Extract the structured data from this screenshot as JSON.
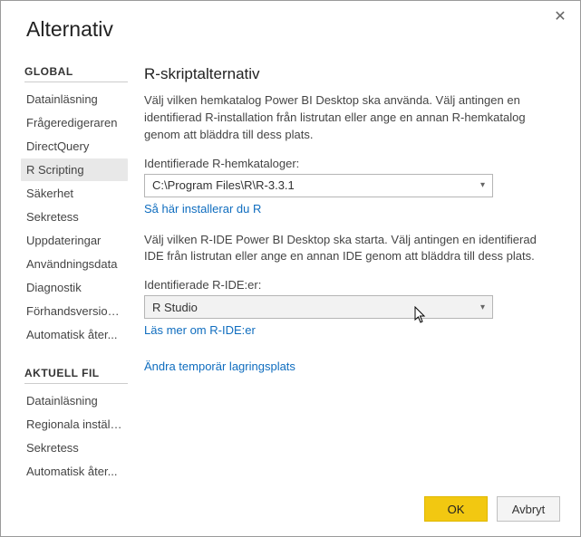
{
  "window": {
    "title": "Alternativ"
  },
  "sidebar": {
    "global_label": "GLOBAL",
    "aktuell_label": "AKTUELL FIL",
    "global_items": [
      "Datainläsning",
      "Frågeredigeraren",
      "DirectQuery",
      "R Scripting",
      "Säkerhet",
      "Sekretess",
      "Uppdateringar",
      "Användningsdata",
      "Diagnostik",
      "Förhandsversions...",
      "Automatisk åter..."
    ],
    "aktuell_items": [
      "Datainläsning",
      "Regionala inställ...",
      "Sekretess",
      "Automatisk åter..."
    ],
    "selected_global_index": 3
  },
  "main": {
    "heading": "R-skriptalternativ",
    "para1": "Välj vilken hemkatalog Power BI Desktop ska använda. Välj antingen en identifierad R-installation från listrutan eller ange en annan R-hemkatalog genom att bläddra till dess plats.",
    "label_home": "Identifierade R-hemkataloger:",
    "dropdown_home": "C:\\Program Files\\R\\R-3.3.1",
    "link_install": "Så här installerar du R",
    "para2": "Välj vilken R-IDE Power BI Desktop ska starta. Välj antingen en identifierad IDE från listrutan eller ange en annan IDE genom att bläddra till dess plats.",
    "label_ide": "Identifierade R-IDE:er:",
    "dropdown_ide": "R Studio",
    "link_ide": "Läs mer om R-IDE:er",
    "link_temp": "Ändra temporär lagringsplats"
  },
  "footer": {
    "ok": "OK",
    "cancel": "Avbryt"
  }
}
